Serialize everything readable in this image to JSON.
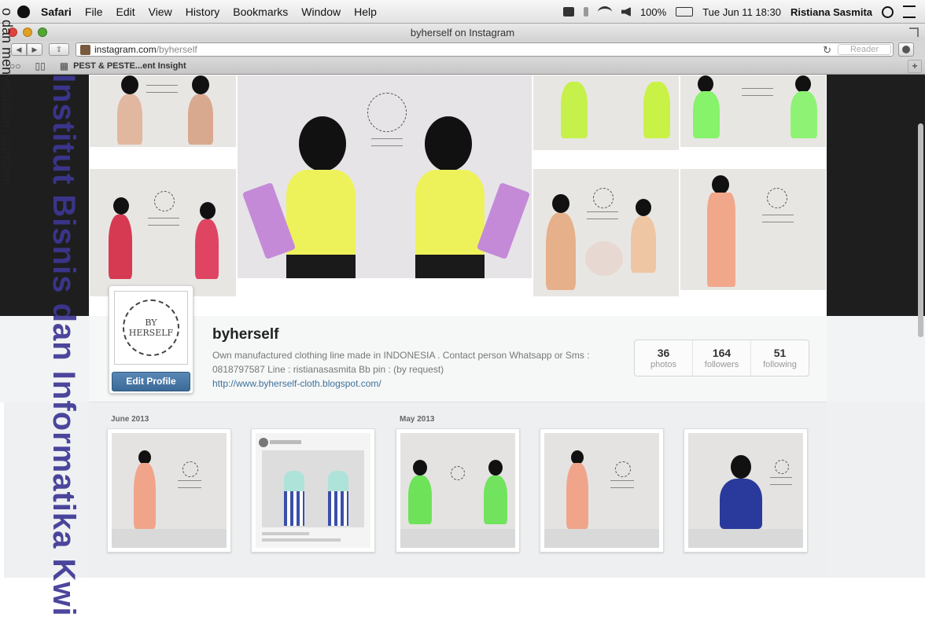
{
  "menubar": {
    "app": "Safari",
    "items": [
      "File",
      "Edit",
      "View",
      "History",
      "Bookmarks",
      "Window",
      "Help"
    ],
    "battery": "100%",
    "datetime": "Tue Jun 11  18:30",
    "user": "Ristiana Sasmita"
  },
  "window": {
    "title": "byherself on Instagram",
    "url_host": "instagram.com",
    "url_path": "/byherself",
    "reader_label": "Reader",
    "bookmark": "PEST & PESTE...ent Insight"
  },
  "profile": {
    "username": "byherself",
    "bio": "Own manufactured clothing line made in INDONESIA . Contact person Whatsapp or Sms : 0818797587 Line : ristianasasmita Bb pin : (by request)",
    "link": "http://www.byherself-cloth.blogspot.com/",
    "edit_label": "Edit Profile",
    "avatar_text_top": "BY",
    "avatar_text_bottom": "HERSELF",
    "stats": [
      {
        "num": "36",
        "label": "photos"
      },
      {
        "num": "164",
        "label": "followers"
      },
      {
        "num": "51",
        "label": "following"
      }
    ]
  },
  "grid": {
    "months": [
      "June 2013",
      "May 2013"
    ]
  },
  "watermark": {
    "main": "Institut Bisnis dan Informatika Kwi",
    "side": "o dan menyebutkan sumber:"
  },
  "colors": {
    "link": "#3f729b",
    "button": "#3c6a97",
    "watermark": "#3d3794"
  }
}
